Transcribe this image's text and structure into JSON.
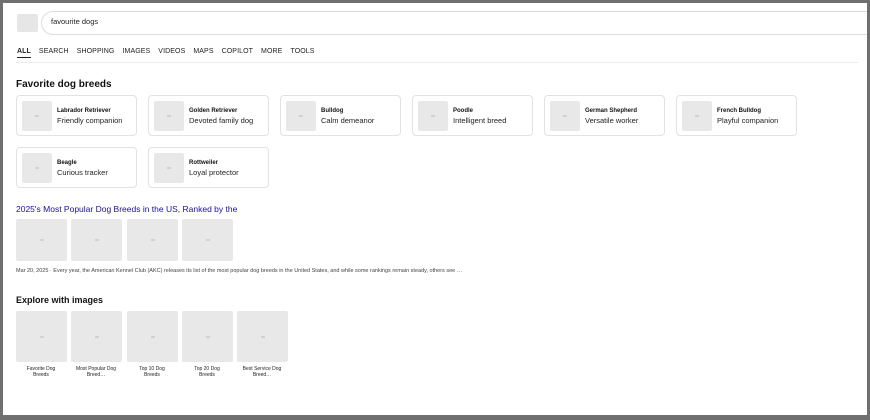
{
  "search": {
    "query": "favourite dogs"
  },
  "tabs": [
    "ALL",
    "SEARCH",
    "SHOPPING",
    "IMAGES",
    "VIDEOS",
    "MAPS",
    "COPILOT",
    "MORE",
    "TOOLS"
  ],
  "breeds_section": {
    "title": "Favorite dog breeds",
    "breeds": [
      {
        "name": "Labrador Retriever",
        "desc": "Friendly companion"
      },
      {
        "name": "Golden Retriever",
        "desc": "Devoted family dog"
      },
      {
        "name": "Bulldog",
        "desc": "Calm demeanor"
      },
      {
        "name": "Poodle",
        "desc": "Intelligent breed"
      },
      {
        "name": "German Shepherd",
        "desc": "Versatile worker"
      },
      {
        "name": "French Bulldog",
        "desc": "Playful companion"
      },
      {
        "name": "Beagle",
        "desc": "Curious tracker"
      },
      {
        "name": "Rottweiler",
        "desc": "Loyal protector"
      }
    ]
  },
  "result": {
    "title": "2025's Most Popular Dog Breeds in the US, Ranked by the",
    "snippet": "Mar 20, 2025 · Every year, the American Kennel Club (AKC) releases its list of the most popular dog breeds in the United States, and while some rankings remain steady, others see …"
  },
  "explore": {
    "title": "Explore with images",
    "items": [
      {
        "line1": "Favorite Dog",
        "line2": "Breeds"
      },
      {
        "line1": "Most Popular Dog",
        "line2": "Breed…"
      },
      {
        "line1": "Top 10 Dog",
        "line2": "Breeds"
      },
      {
        "line1": "Top 20 Dog",
        "line2": "Breeds"
      },
      {
        "line1": "Best Service Dog",
        "line2": "Breed…"
      }
    ]
  },
  "colors": {
    "link": "#1a0dab",
    "page_border": "#6f6f6f",
    "placeholder": "#e8e8e8"
  }
}
